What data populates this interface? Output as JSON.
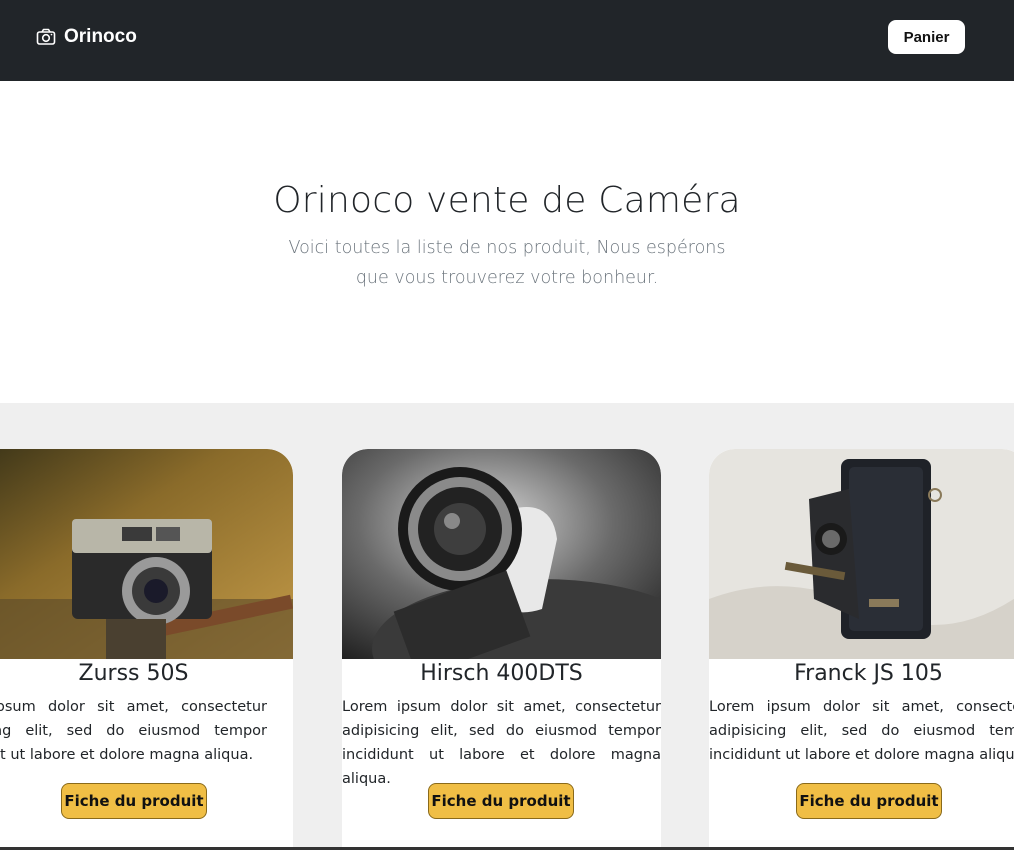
{
  "navbar": {
    "brand": "Orinoco",
    "brand_icon": "camera-icon",
    "cart_label": "Panier",
    "bg_color": "#212529"
  },
  "hero": {
    "title": "Orinoco vente de Caméra",
    "subtitle": "Voici toutes la liste de nos produit, Nous espérons que vous trouverez votre bonheur."
  },
  "products": [
    {
      "name": "Zurss 50S",
      "description": "Lorem ipsum dolor sit amet, consectetur adipisicing elit, sed do eiusmod tempor incididunt ut labore et dolore magna aliqua.",
      "button": "Fiche du produit"
    },
    {
      "name": "Hirsch 400DTS",
      "description": "Lorem ipsum dolor sit amet, consectetur adipisicing elit, sed do eiusmod tempor incididunt ut labore et dolore magna aliqua.",
      "button": "Fiche du produit"
    },
    {
      "name": "Franck JS 105",
      "description": "Lorem ipsum dolor sit amet, consectetur adipisicing elit, sed do eiusmod tempor incididunt ut labore et dolore magna aliqua.",
      "button": "Fiche du produit"
    }
  ],
  "colors": {
    "accent_button": "#f0be45",
    "section_bg": "#efefef"
  }
}
